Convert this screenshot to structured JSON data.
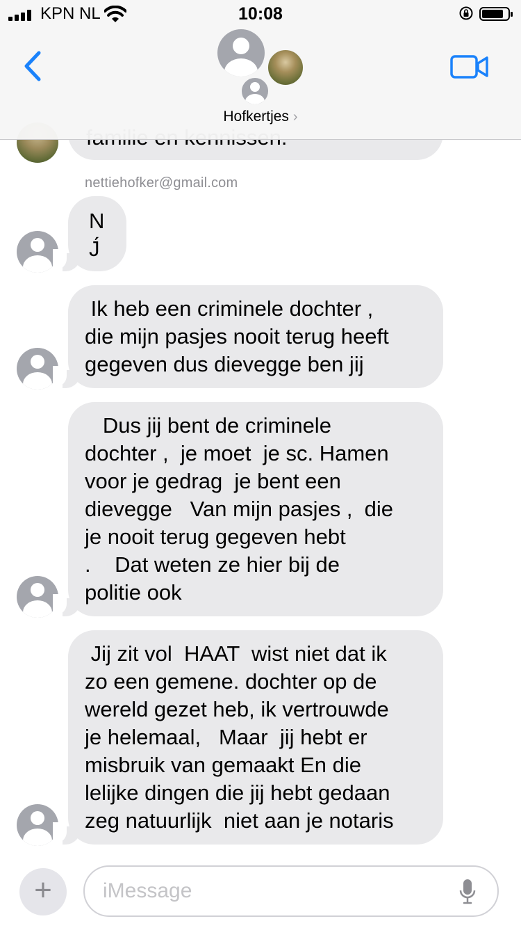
{
  "status_bar": {
    "carrier": "KPN NL",
    "time": "10:08",
    "battery_level": 0.8
  },
  "header": {
    "group_name": "Hofkertjes",
    "chevron": "›",
    "back_icon": "chevron-left-icon",
    "video_icon": "video-camera-icon",
    "accent_color": "#1a82fb"
  },
  "messages": {
    "partial_text": "familie en kennissen.",
    "sender_email": "nettiehofker@gmail.com",
    "m1": "N\nJ́",
    "m2": " Ik heb een criminele dochter ,\ndie mijn pasjes nooit terug heeft\ngegeven dus dievegge ben jij",
    "m3": "   Dus jij bent de criminele\ndochter ,  je moet  je sc. Hamen\nvoor je gedrag  je bent een\ndievegge   Van mijn pasjes ,  die\nje nooit terug gegeven hebt\n.    Dat weten ze hier bij de\npolitie ook",
    "m4": " Jij zit vol  HAAT  wist niet dat ik\nzo een gemene. dochter op de\nwereld gezet heb, ik vertrouwde\nje helemaal,   Maar  jij hebt er\nmisbruik van gemaakt En die\nlelijke dingen die jij hebt gedaan\nzeg natuurlijk  niet aan je notaris"
  },
  "composer": {
    "plus_label": "+",
    "placeholder": "iMessage",
    "mic_icon": "microphone-icon"
  },
  "colors": {
    "bubble_gray": "#e9e9eb",
    "avatar_gray": "#a4a6ad"
  }
}
